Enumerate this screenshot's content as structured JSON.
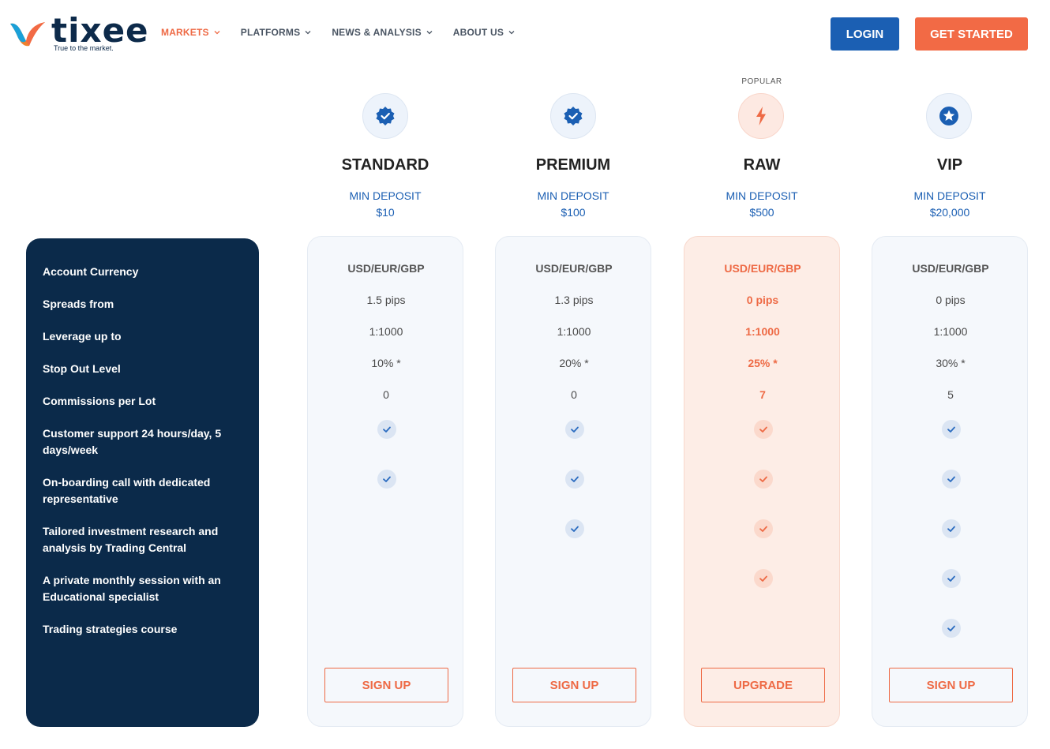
{
  "brand": {
    "name": "tixee",
    "tagline": "True to the market.",
    "colors": {
      "primary": "#1b5fb3",
      "accent": "#f26a45",
      "dark": "#0b2a4a"
    }
  },
  "nav": [
    {
      "label": "MARKETS",
      "active": true
    },
    {
      "label": "PLATFORMS",
      "active": false
    },
    {
      "label": "NEWS & ANALYSIS",
      "active": false
    },
    {
      "label": "ABOUT US",
      "active": false
    }
  ],
  "header_buttons": {
    "login": "LOGIN",
    "get_started": "GET STARTED"
  },
  "features": [
    "Account Currency",
    "Spreads from",
    "Leverage up to",
    "Stop Out Level",
    "Commissions per Lot",
    "Customer support 24 hours/day, 5 days/week",
    "On-boarding call with dedicated representative",
    "Tailored investment research and analysis by Trading Central",
    "A private monthly session with an Educational specialist",
    "Trading strategies course"
  ],
  "popular_label": "POPULAR",
  "plans": [
    {
      "name": "STANDARD",
      "icon": "verified-badge-icon",
      "min_deposit_label": "MIN DEPOSIT",
      "min_deposit": "$10",
      "currency": "USD/EUR/GBP",
      "spreads": "1.5 pips",
      "leverage": "1:1000",
      "stop_out": "10% *",
      "commission": "0",
      "checks": [
        true,
        true,
        false,
        false,
        false
      ],
      "cta": "SIGN UP"
    },
    {
      "name": "PREMIUM",
      "icon": "verified-badge-icon",
      "min_deposit_label": "MIN DEPOSIT",
      "min_deposit": "$100",
      "currency": "USD/EUR/GBP",
      "spreads": "1.3 pips",
      "leverage": "1:1000",
      "stop_out": "20% *",
      "commission": "0",
      "checks": [
        true,
        true,
        true,
        false,
        false
      ],
      "cta": "SIGN UP"
    },
    {
      "name": "RAW",
      "icon": "lightning-icon",
      "min_deposit_label": "MIN DEPOSIT",
      "min_deposit": "$500",
      "currency": "USD/EUR/GBP",
      "spreads": "0 pips",
      "leverage": "1:1000",
      "stop_out": "25% *",
      "commission": "7",
      "checks": [
        true,
        true,
        true,
        true,
        false
      ],
      "cta": "UPGRADE"
    },
    {
      "name": "VIP",
      "icon": "star-badge-icon",
      "min_deposit_label": "MIN DEPOSIT",
      "min_deposit": "$20,000",
      "currency": "USD/EUR/GBP",
      "spreads": "0 pips",
      "leverage": "1:1000",
      "stop_out": "30% *",
      "commission": "5",
      "checks": [
        true,
        true,
        true,
        true,
        true
      ],
      "cta": "SIGN UP"
    }
  ]
}
